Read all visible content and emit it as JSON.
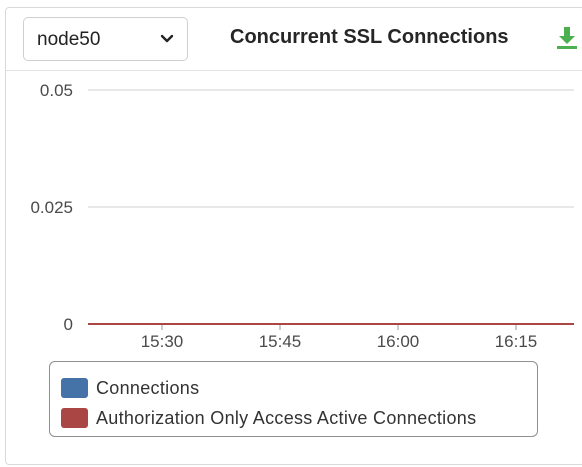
{
  "node_select": {
    "value": "node50",
    "icon": "chevron-down-icon"
  },
  "header": {
    "title": "Concurrent SSL Connections",
    "download_icon": "download-icon",
    "download_color": "#4caf50"
  },
  "chart_data": {
    "type": "line",
    "title": "Concurrent SSL Connections",
    "xlabel": "",
    "ylabel": "",
    "y_ticks": [
      "0.05",
      "0.025",
      "0"
    ],
    "ylim": [
      0,
      0.05
    ],
    "x_ticks": [
      "15:30",
      "15:45",
      "16:00",
      "16:15"
    ],
    "grid": true,
    "legend_position": "bottom",
    "series": [
      {
        "name": "Connections",
        "color": "#4572a7",
        "values": [
          0,
          0,
          0,
          0,
          0
        ]
      },
      {
        "name": "Authorization Only Access Active Connections",
        "color": "#aa4643",
        "values": [
          0,
          0,
          0,
          0,
          0
        ]
      }
    ]
  }
}
